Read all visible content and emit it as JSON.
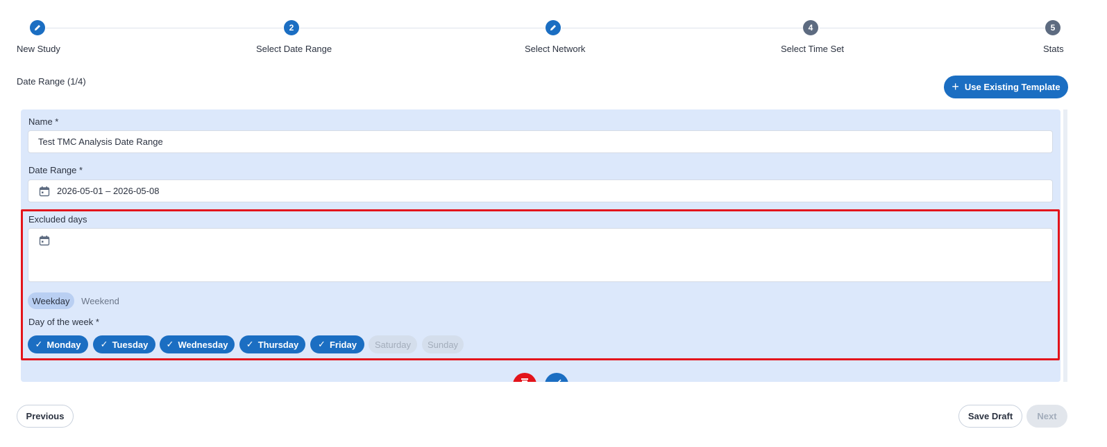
{
  "stepper": {
    "steps": [
      {
        "label": "New Study",
        "marker": "pencil-icon",
        "state": "done"
      },
      {
        "label": "Select Date Range",
        "marker": "2",
        "state": "current"
      },
      {
        "label": "Select Network",
        "marker": "pencil-icon",
        "state": "done"
      },
      {
        "label": "Select Time Set",
        "marker": "4",
        "state": "pending"
      },
      {
        "label": "Stats",
        "marker": "5",
        "state": "pending"
      }
    ]
  },
  "section": {
    "title": "Date Range (1/4)"
  },
  "template_button": {
    "label": "Use Existing Template",
    "icon": "plus-icon"
  },
  "form": {
    "name_label": "Name *",
    "name_value": "Test TMC Analysis Date Range",
    "date_range_label": "Date Range *",
    "date_range_value": "2026-05-01 – 2026-05-08",
    "excluded_label": "Excluded days",
    "excluded_value": "",
    "day_type_toggle": {
      "options": [
        "Weekday",
        "Weekend"
      ],
      "selected": "Weekday"
    },
    "dow_label": "Day of the week *",
    "days": [
      {
        "label": "Monday",
        "checked": true
      },
      {
        "label": "Tuesday",
        "checked": true
      },
      {
        "label": "Wednesday",
        "checked": true
      },
      {
        "label": "Thursday",
        "checked": true
      },
      {
        "label": "Friday",
        "checked": true
      },
      {
        "label": "Saturday",
        "checked": false
      },
      {
        "label": "Sunday",
        "checked": false
      }
    ]
  },
  "actions": {
    "delete_icon": "trash-icon",
    "confirm_icon": "check-icon"
  },
  "footer": {
    "previous": "Previous",
    "save_draft": "Save Draft",
    "next": "Next"
  },
  "colors": {
    "primary": "#1b6ec2",
    "panel": "#dce8fb",
    "highlight": "#e3141b",
    "delete": "#e3141b"
  }
}
